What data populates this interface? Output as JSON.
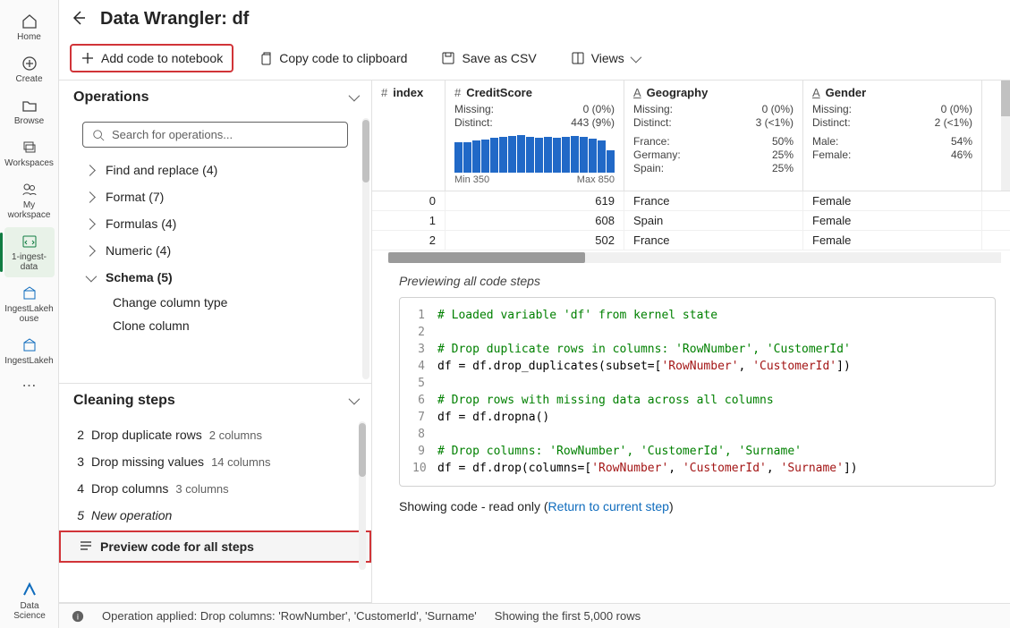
{
  "nav": [
    {
      "icon": "home",
      "label": "Home"
    },
    {
      "icon": "plus-circle",
      "label": "Create"
    },
    {
      "icon": "folder",
      "label": "Browse"
    },
    {
      "icon": "stack",
      "label": "Workspaces"
    },
    {
      "icon": "people",
      "label": "My workspace"
    },
    {
      "icon": "code",
      "label": "1-ingest-data",
      "active": true
    },
    {
      "icon": "lakehouse",
      "label": "IngestLakeh ouse"
    },
    {
      "icon": "lakehouse2",
      "label": "IngestLakeh"
    }
  ],
  "page_title": "Data Wrangler: df",
  "toolbar": {
    "add_code": "Add code to notebook",
    "copy_code": "Copy code to clipboard",
    "save_csv": "Save as CSV",
    "views": "Views"
  },
  "operations": {
    "title": "Operations",
    "search_placeholder": "Search for operations...",
    "groups": [
      {
        "label": "Find and replace (4)",
        "expanded": false
      },
      {
        "label": "Format (7)",
        "expanded": false
      },
      {
        "label": "Formulas (4)",
        "expanded": false
      },
      {
        "label": "Numeric (4)",
        "expanded": false
      },
      {
        "label": "Schema (5)",
        "expanded": true,
        "children": [
          "Change column type",
          "Clone column"
        ]
      }
    ]
  },
  "cleaning": {
    "title": "Cleaning steps",
    "steps": [
      {
        "n": "2",
        "label": "Drop duplicate rows",
        "meta": "2 columns"
      },
      {
        "n": "3",
        "label": "Drop missing values",
        "meta": "14 columns"
      },
      {
        "n": "4",
        "label": "Drop columns",
        "meta": "3 columns"
      },
      {
        "n": "5",
        "label": "New operation",
        "italic": true
      }
    ],
    "preview_label": "Preview code for all steps"
  },
  "columns": [
    {
      "name": "index",
      "icon": "#",
      "narrow": true
    },
    {
      "name": "CreditScore",
      "icon": "#",
      "missing": "0 (0%)",
      "distinct": "443 (9%)",
      "histogram": [
        80,
        82,
        85,
        88,
        92,
        95,
        98,
        100,
        95,
        92,
        95,
        92,
        95,
        98,
        95,
        90,
        85,
        60
      ],
      "min": "Min 350",
      "max": "Max 850"
    },
    {
      "name": "Geography",
      "icon": "A",
      "missing": "0 (0%)",
      "distinct": "3 (<1%)",
      "values": [
        [
          "France:",
          "50%"
        ],
        [
          "Germany:",
          "25%"
        ],
        [
          "Spain:",
          "25%"
        ]
      ]
    },
    {
      "name": "Gender",
      "icon": "A",
      "missing": "0 (0%)",
      "distinct": "2 (<1%)",
      "values": [
        [
          "Male:",
          "54%"
        ],
        [
          "Female:",
          "46%"
        ]
      ]
    }
  ],
  "data_rows": [
    {
      "idx": "0",
      "credit": "619",
      "geo": "France",
      "gender": "Female"
    },
    {
      "idx": "1",
      "credit": "608",
      "geo": "Spain",
      "gender": "Female"
    },
    {
      "idx": "2",
      "credit": "502",
      "geo": "France",
      "gender": "Female"
    }
  ],
  "code_preview": {
    "heading": "Previewing all code steps",
    "lines": [
      {
        "n": 1,
        "segs": [
          {
            "cls": "c-comment",
            "t": "# Loaded variable 'df' from kernel state"
          }
        ]
      },
      {
        "n": 2,
        "segs": []
      },
      {
        "n": 3,
        "segs": [
          {
            "cls": "c-comment",
            "t": "# Drop duplicate rows in columns: 'RowNumber', 'CustomerId'"
          }
        ]
      },
      {
        "n": 4,
        "segs": [
          {
            "cls": "c-plain",
            "t": "df = df.drop_duplicates(subset=["
          },
          {
            "cls": "c-str",
            "t": "'RowNumber'"
          },
          {
            "cls": "c-plain",
            "t": ", "
          },
          {
            "cls": "c-str",
            "t": "'CustomerId'"
          },
          {
            "cls": "c-plain",
            "t": "])"
          }
        ]
      },
      {
        "n": 5,
        "segs": []
      },
      {
        "n": 6,
        "segs": [
          {
            "cls": "c-comment",
            "t": "# Drop rows with missing data across all columns"
          }
        ]
      },
      {
        "n": 7,
        "segs": [
          {
            "cls": "c-plain",
            "t": "df = df.dropna()"
          }
        ]
      },
      {
        "n": 8,
        "segs": []
      },
      {
        "n": 9,
        "segs": [
          {
            "cls": "c-comment",
            "t": "# Drop columns: 'RowNumber', 'CustomerId', 'Surname'"
          }
        ]
      },
      {
        "n": 10,
        "segs": [
          {
            "cls": "c-plain",
            "t": "df = df.drop(columns=["
          },
          {
            "cls": "c-str",
            "t": "'RowNumber'"
          },
          {
            "cls": "c-plain",
            "t": ", "
          },
          {
            "cls": "c-str",
            "t": "'CustomerId'"
          },
          {
            "cls": "c-plain",
            "t": ", "
          },
          {
            "cls": "c-str",
            "t": "'Surname'"
          },
          {
            "cls": "c-plain",
            "t": "])"
          }
        ]
      }
    ],
    "footer_text": "Showing code - read only (",
    "footer_link": "Return to current step",
    "footer_close": ")"
  },
  "status": {
    "msg": "Operation applied: Drop columns: 'RowNumber', 'CustomerId', 'Surname'",
    "rows": "Showing the first 5,000 rows"
  },
  "footer_brand": "Data Science"
}
